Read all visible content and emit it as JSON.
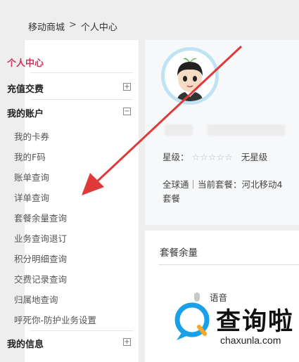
{
  "breadcrumb": {
    "home": "移动商城",
    "separator": ">",
    "current": "个人中心"
  },
  "sidebar": {
    "personal_center": "个人中心",
    "recharge": "充值交费",
    "my_account": "我的账户",
    "account_items": [
      "我的卡券",
      "我的F码",
      "账单查询",
      "详单查询",
      "套餐余量查询",
      "业务查询退订",
      "积分明细查询",
      "交费记录查询",
      "归属地查询",
      "呼死你-防护业务设置"
    ],
    "my_info": "我的信息",
    "plus": "+",
    "minus": "−"
  },
  "profile": {
    "star_label": "星级：",
    "star_glyphs": "☆☆☆☆☆",
    "star_value": "无星级",
    "plan_line": "全球通｜当前套餐：河北移动4",
    "plan_line2": "套餐"
  },
  "balance": {
    "title": "套餐余量",
    "voice": "语音"
  },
  "watermark": {
    "text": "查询啦",
    "url": "chaxunla.com"
  },
  "colors": {
    "accent": "#c8365e",
    "arrow": "#e0393a",
    "watermark_blue": "#1aa0e8"
  }
}
